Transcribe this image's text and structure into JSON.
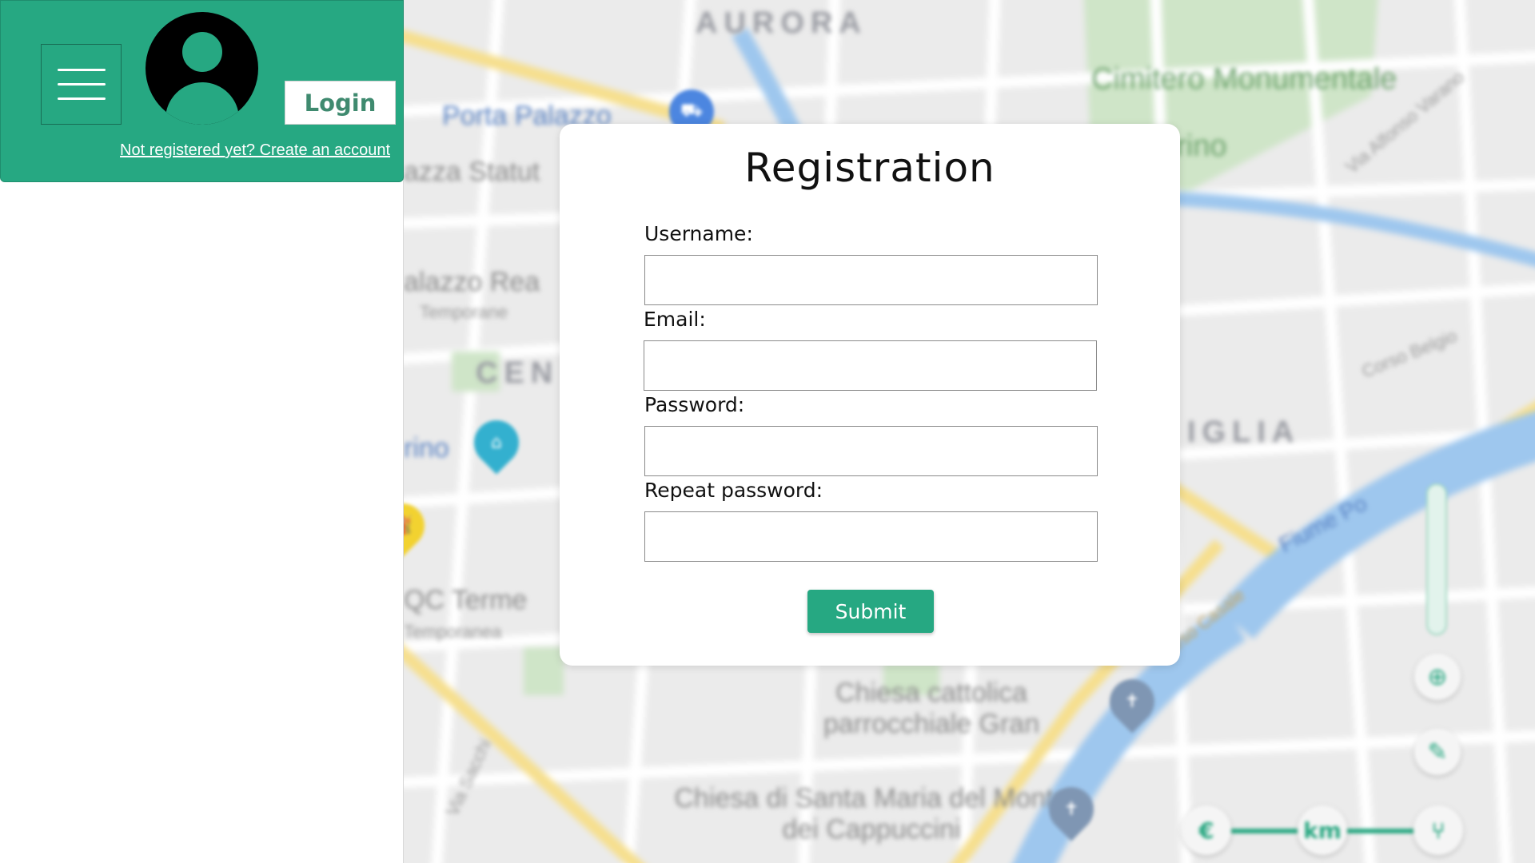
{
  "header": {
    "menu_icon": "hamburger-icon",
    "avatar_icon": "user-avatar-icon",
    "login_label": "Login",
    "register_link": "Not registered yet? Create an account"
  },
  "registration": {
    "title": "Registration",
    "fields": [
      {
        "label": "Username:",
        "value": ""
      },
      {
        "label": "Email:",
        "value": ""
      },
      {
        "label": "Password:",
        "value": ""
      },
      {
        "label": "Repeat password:",
        "value": ""
      }
    ],
    "submit_label": "Submit"
  },
  "map": {
    "labels": {
      "aurora": "AURORA",
      "porta_palazzo": "Porta Palazzo",
      "piazza_statuto": "azza Statut",
      "cimitero": "Cimitero Monumentale",
      "torino": "orino",
      "palazzo_reale": "alazzo Rea",
      "temporaneo1": "Temporane",
      "centro": "CEN",
      "torino_station": "rino",
      "vanchiglia": "IGLIA",
      "qc_terme": "QC Terme",
      "temporaneo2": "Temporanea",
      "chiesa1": "Chiesa cattolica parrocchiale Gran",
      "chiesa2": "Chiesa di Santa Maria del Monte dei Cappuccini",
      "fiume_po": "Fiume Po",
      "corso_casale": "Corso Casale",
      "corso_belgio": "Corso Belgio",
      "via_alfonso": "Via Alfonso Varano",
      "via_sacchi": "Via Sacchi"
    },
    "controls": {
      "locate_icon": "locate-icon",
      "layers_icon": "layers-icon",
      "euro_label": "€",
      "km_label": "km",
      "route_icon": "route-icon"
    },
    "colors": {
      "accent": "#26a882",
      "river": "#9ec7ee",
      "park": "#cfe5c8",
      "road_major": "#f6df8e"
    }
  }
}
